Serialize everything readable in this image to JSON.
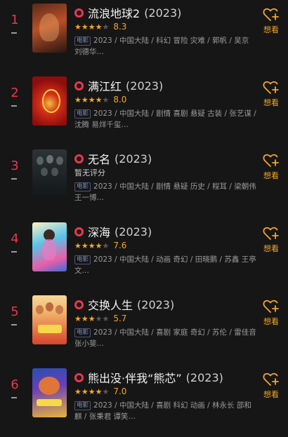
{
  "movies": [
    {
      "rank": "1",
      "title": "流浪地球2",
      "year": "(2023)",
      "stars": "★★★★",
      "stars_empty": "★",
      "score": "8.3",
      "badge": "电影",
      "meta": "2023 / 中国大陆 / 科幻 冒险 灾难 / 郭帆 / 吴京 刘德华…",
      "want_label": "想看",
      "poster_colors": [
        "#3a1e14",
        "#b8502a"
      ]
    },
    {
      "rank": "2",
      "title": "满江红",
      "year": "(2023)",
      "stars": "★★★★",
      "stars_empty": "★",
      "score": "8.0",
      "badge": "电影",
      "meta": "2023 / 中国大陆 / 剧情 喜剧 悬疑 古装 / 张艺谋 / 沈腾 易烊千玺…",
      "want_label": "想看",
      "poster_colors": [
        "#8e0d0d",
        "#d23018"
      ]
    },
    {
      "rank": "3",
      "title": "无名",
      "year": "(2023)",
      "stars": "",
      "stars_empty": "",
      "score": "",
      "no_score": "暂无评分",
      "badge": "电影",
      "meta": "2023 / 中国大陆 / 剧情 悬疑 历史 / 程耳 / 梁朝伟 王一博…",
      "want_label": "想看",
      "poster_colors": [
        "#121618",
        "#3d4446"
      ]
    },
    {
      "rank": "4",
      "title": "深海",
      "year": "(2023)",
      "stars": "★★★★",
      "stars_empty": "★",
      "score": "7.6",
      "badge": "电影",
      "meta": "2023 / 中国大陆 / 动画 奇幻 / 田晓鹏 / 苏鑫 王亭文…",
      "want_label": "想看",
      "poster_colors": [
        "#58c3e8",
        "#e85fa8"
      ]
    },
    {
      "rank": "5",
      "title": "交换人生",
      "year": "(2023)",
      "stars": "★★★",
      "stars_empty": "★★",
      "score": "5.7",
      "badge": "电影",
      "meta": "2023 / 中国大陆 / 喜剧 家庭 奇幻 / 苏伦 / 雷佳音 张小斐…",
      "want_label": "想看",
      "poster_colors": [
        "#f0b36a",
        "#d8452c"
      ]
    },
    {
      "rank": "6",
      "title": "熊出没·伴我“熊芯”",
      "year": "(2023)",
      "stars": "★★★★",
      "stars_empty": "★",
      "score": "7.0",
      "badge": "电影",
      "meta": "2023 / 中国大陆 / 喜剧 科幻 动画 / 林永长 邵和麒 / 张秉君 谭笑…",
      "want_label": "想看",
      "poster_colors": [
        "#2a4fb0",
        "#e8b43a"
      ]
    }
  ],
  "colors": {
    "rank": "#e8384f",
    "accent": "#f5a623",
    "background": "#161616"
  }
}
